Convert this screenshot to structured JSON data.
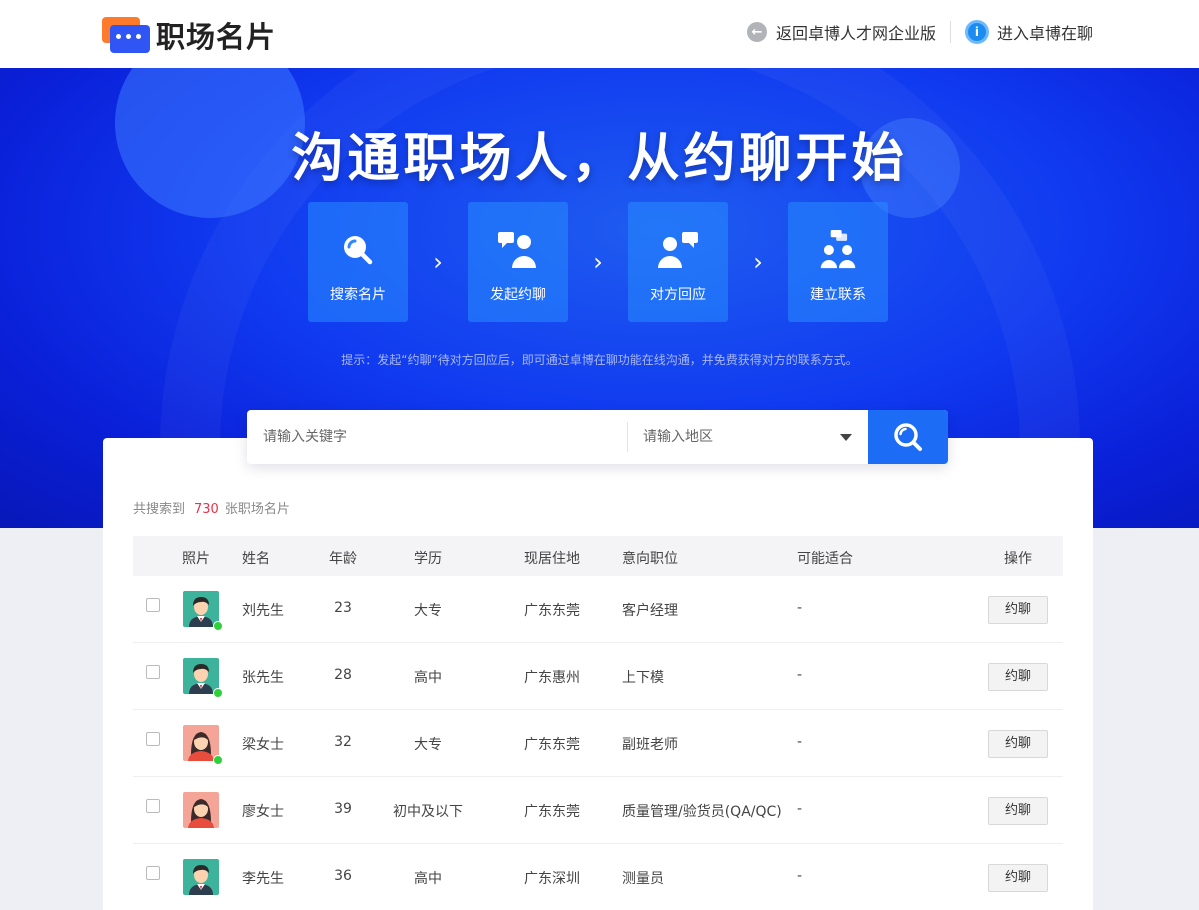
{
  "header": {
    "logo_text": "职场名片",
    "nav": [
      {
        "label": "返回卓博人才网企业版",
        "icon": "back-arrow-icon"
      },
      {
        "label": "进入卓博在聊",
        "icon": "chat-bubble-icon"
      }
    ]
  },
  "banner": {
    "title": "沟通职场人，从约聊开始",
    "steps": [
      {
        "label": "搜索名片",
        "icon": "search-icon"
      },
      {
        "label": "发起约聊",
        "icon": "person-message-icon"
      },
      {
        "label": "对方回应",
        "icon": "person-reply-icon"
      },
      {
        "label": "建立联系",
        "icon": "group-contact-icon"
      }
    ],
    "tip": "提示：发起“约聊”待对方回应后，即可通过卓博在聊功能在线沟通，并免费获得对方的联系方式。"
  },
  "search": {
    "keyword_placeholder": "请输入关键字",
    "region_placeholder": "请输入地区"
  },
  "results": {
    "prefix": "共搜索到",
    "count": "730",
    "suffix": "张职场名片"
  },
  "table": {
    "columns": [
      "照片",
      "姓名",
      "年龄",
      "学历",
      "现居住地",
      "意向职位",
      "可能适合",
      "操作"
    ],
    "rows": [
      {
        "name": "刘先生",
        "age": "23",
        "education": "大专",
        "location": "广东东莞",
        "position": "客户经理",
        "fit": "-",
        "action": "约聊",
        "gender": "male",
        "online": true
      },
      {
        "name": "张先生",
        "age": "28",
        "education": "高中",
        "location": "广东惠州",
        "position": "上下模",
        "fit": "-",
        "action": "约聊",
        "gender": "male",
        "online": true
      },
      {
        "name": "梁女士",
        "age": "32",
        "education": "大专",
        "location": "广东东莞",
        "position": "副班老师",
        "fit": "-",
        "action": "约聊",
        "gender": "female",
        "online": true
      },
      {
        "name": "廖女士",
        "age": "39",
        "education": "初中及以下",
        "location": "广东东莞",
        "position": "质量管理/验货员(QA/QC)",
        "fit": "-",
        "action": "约聊",
        "gender": "female",
        "online": false
      },
      {
        "name": "李先生",
        "age": "36",
        "education": "高中",
        "location": "广东深圳",
        "position": "测量员",
        "fit": "-",
        "action": "约聊",
        "gender": "male",
        "online": false
      }
    ]
  },
  "colors": {
    "brand_blue": "#1c6cf5",
    "logo_orange": "#ff7a2a",
    "count_red": "#e8334a",
    "online_green": "#2fd13a",
    "male_avatar_bg": "#3cb39a",
    "female_avatar_bg": "#f5a597"
  }
}
